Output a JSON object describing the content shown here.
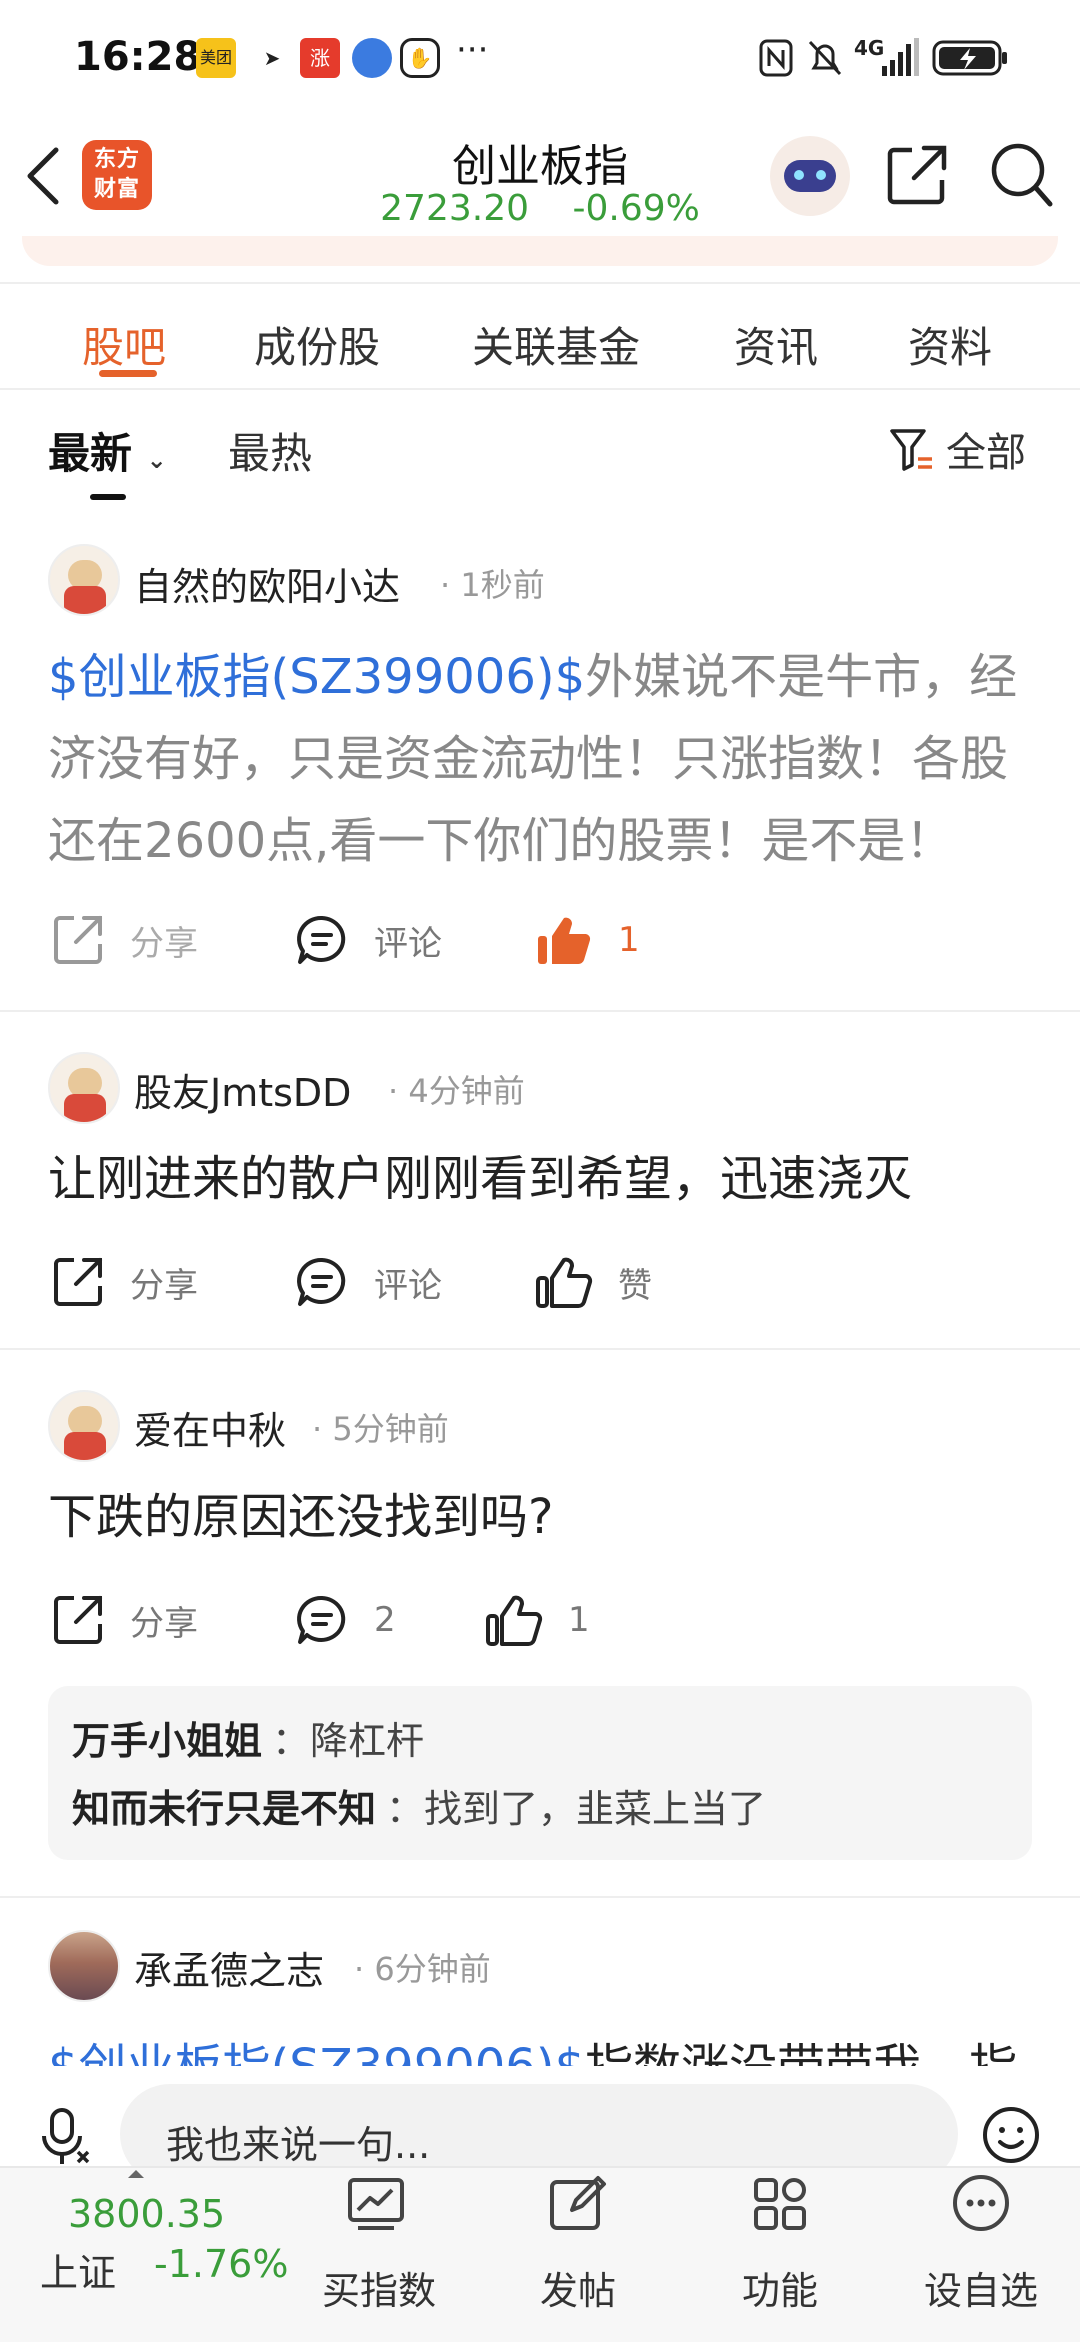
{
  "status_bar": {
    "time": "16:28",
    "badges": [
      "meituan-app-icon",
      "feishu-app-icon",
      "zhang-app-icon",
      "browser-app-icon",
      "hand-app-icon"
    ],
    "more": "···",
    "network": "4G"
  },
  "header": {
    "app_logo_text": "东方财富",
    "title": "创业板指",
    "price": "2723.20",
    "change": "-0.69%"
  },
  "tabs": [
    "股吧",
    "成份股",
    "关联基金",
    "资讯",
    "资料"
  ],
  "active_tab": "股吧",
  "subtabs": {
    "latest": "最新",
    "hot": "最热",
    "filter": "全部"
  },
  "posts": [
    {
      "author": "自然的欧阳小达",
      "time": "1秒前",
      "tag": "$创业板指(SZ399006)$",
      "text": "外媒说不是牛市，经济没有好，只是资金流动性！只涨指数！各股还在2600点,看一下你们的股票！是不是！",
      "share": "分享",
      "comment": "评论",
      "like": "1"
    },
    {
      "author": "股友JmtsDD",
      "time": "4分钟前",
      "text": "让刚进来的散户刚刚看到希望，迅速浇灭",
      "share": "分享",
      "comment": "评论",
      "like": "赞"
    },
    {
      "author": "爱在中秋",
      "time": "5分钟前",
      "text": "下跌的原因还没找到吗?",
      "share": "分享",
      "comment": "2",
      "like": "1",
      "replies": [
        {
          "user": "万手小姐姐",
          "text": "：降杠杆"
        },
        {
          "user": "知而未行只是不知",
          "text": "：找到了，韭菜上当了"
        }
      ]
    },
    {
      "author": "承孟德之志",
      "time": "6分钟前",
      "tag": "$创业板指(SZ399006)$",
      "text": "指数涨没带带我，指"
    }
  ],
  "comment_bar": {
    "placeholder": "我也来说一句..."
  },
  "bottom_nav": {
    "index_value": "3800.35",
    "index_name": "上证",
    "index_change": "-1.76%",
    "items": [
      "买指数",
      "发帖",
      "功能",
      "设自选"
    ]
  },
  "colors": {
    "accent": "#e5622b",
    "down": "#3a9d3a",
    "link": "#2f6fd9"
  }
}
